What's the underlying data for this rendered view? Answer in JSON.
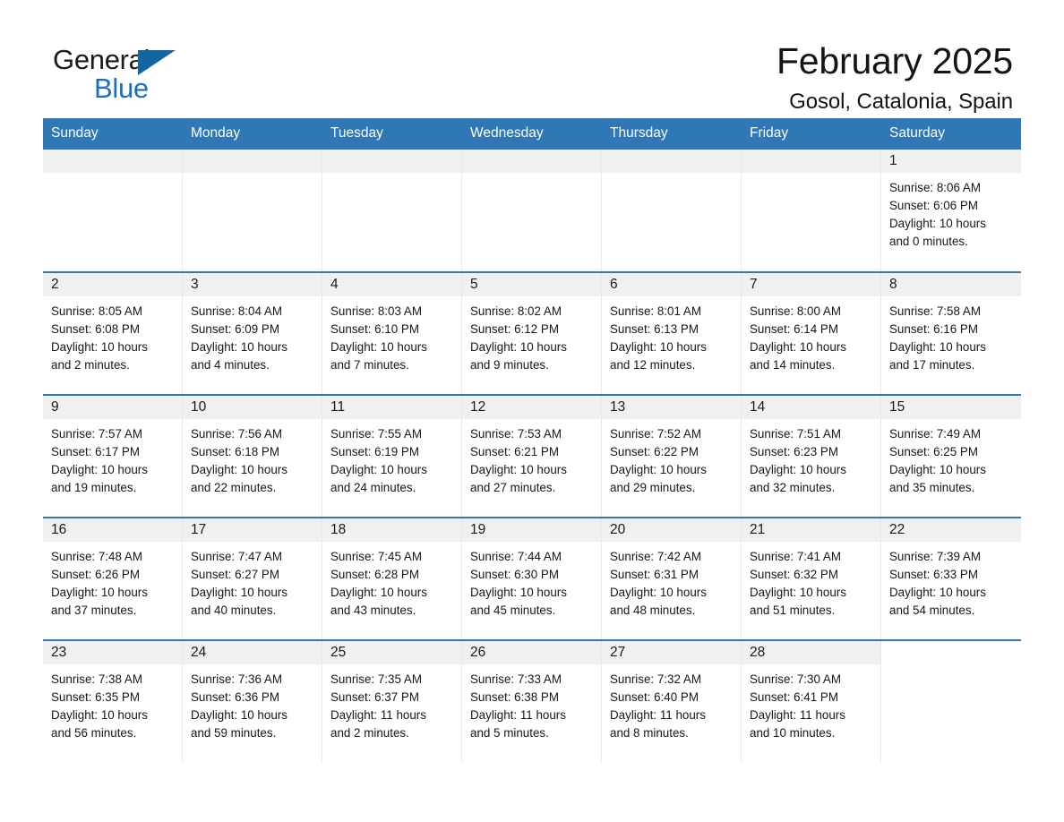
{
  "brand": {
    "name_part1": "General",
    "name_part2": "Blue",
    "logo_icon": "triangle-flag-icon",
    "colors": {
      "blue": "#1a6fc4",
      "triangle": "#12659e"
    }
  },
  "header": {
    "month_title": "February 2025",
    "location": "Gosol, Catalonia, Spain"
  },
  "theme": {
    "header_blue": "#2f78b5",
    "date_band_gray": "#f0f0f0",
    "cell_border": "#e9e9e9",
    "text": "#171717"
  },
  "weekdays": [
    "Sunday",
    "Monday",
    "Tuesday",
    "Wednesday",
    "Thursday",
    "Friday",
    "Saturday"
  ],
  "weeks": [
    [
      {
        "day": "",
        "blank": true
      },
      {
        "day": "",
        "blank": true
      },
      {
        "day": "",
        "blank": true
      },
      {
        "day": "",
        "blank": true
      },
      {
        "day": "",
        "blank": true
      },
      {
        "day": "",
        "blank": true
      },
      {
        "day": "1",
        "sunrise": "Sunrise: 8:06 AM",
        "sunset": "Sunset: 6:06 PM",
        "daylight_1": "Daylight: 10 hours",
        "daylight_2": "and 0 minutes."
      }
    ],
    [
      {
        "day": "2",
        "sunrise": "Sunrise: 8:05 AM",
        "sunset": "Sunset: 6:08 PM",
        "daylight_1": "Daylight: 10 hours",
        "daylight_2": "and 2 minutes."
      },
      {
        "day": "3",
        "sunrise": "Sunrise: 8:04 AM",
        "sunset": "Sunset: 6:09 PM",
        "daylight_1": "Daylight: 10 hours",
        "daylight_2": "and 4 minutes."
      },
      {
        "day": "4",
        "sunrise": "Sunrise: 8:03 AM",
        "sunset": "Sunset: 6:10 PM",
        "daylight_1": "Daylight: 10 hours",
        "daylight_2": "and 7 minutes."
      },
      {
        "day": "5",
        "sunrise": "Sunrise: 8:02 AM",
        "sunset": "Sunset: 6:12 PM",
        "daylight_1": "Daylight: 10 hours",
        "daylight_2": "and 9 minutes."
      },
      {
        "day": "6",
        "sunrise": "Sunrise: 8:01 AM",
        "sunset": "Sunset: 6:13 PM",
        "daylight_1": "Daylight: 10 hours",
        "daylight_2": "and 12 minutes."
      },
      {
        "day": "7",
        "sunrise": "Sunrise: 8:00 AM",
        "sunset": "Sunset: 6:14 PM",
        "daylight_1": "Daylight: 10 hours",
        "daylight_2": "and 14 minutes."
      },
      {
        "day": "8",
        "sunrise": "Sunrise: 7:58 AM",
        "sunset": "Sunset: 6:16 PM",
        "daylight_1": "Daylight: 10 hours",
        "daylight_2": "and 17 minutes."
      }
    ],
    [
      {
        "day": "9",
        "sunrise": "Sunrise: 7:57 AM",
        "sunset": "Sunset: 6:17 PM",
        "daylight_1": "Daylight: 10 hours",
        "daylight_2": "and 19 minutes."
      },
      {
        "day": "10",
        "sunrise": "Sunrise: 7:56 AM",
        "sunset": "Sunset: 6:18 PM",
        "daylight_1": "Daylight: 10 hours",
        "daylight_2": "and 22 minutes."
      },
      {
        "day": "11",
        "sunrise": "Sunrise: 7:55 AM",
        "sunset": "Sunset: 6:19 PM",
        "daylight_1": "Daylight: 10 hours",
        "daylight_2": "and 24 minutes."
      },
      {
        "day": "12",
        "sunrise": "Sunrise: 7:53 AM",
        "sunset": "Sunset: 6:21 PM",
        "daylight_1": "Daylight: 10 hours",
        "daylight_2": "and 27 minutes."
      },
      {
        "day": "13",
        "sunrise": "Sunrise: 7:52 AM",
        "sunset": "Sunset: 6:22 PM",
        "daylight_1": "Daylight: 10 hours",
        "daylight_2": "and 29 minutes."
      },
      {
        "day": "14",
        "sunrise": "Sunrise: 7:51 AM",
        "sunset": "Sunset: 6:23 PM",
        "daylight_1": "Daylight: 10 hours",
        "daylight_2": "and 32 minutes."
      },
      {
        "day": "15",
        "sunrise": "Sunrise: 7:49 AM",
        "sunset": "Sunset: 6:25 PM",
        "daylight_1": "Daylight: 10 hours",
        "daylight_2": "and 35 minutes."
      }
    ],
    [
      {
        "day": "16",
        "sunrise": "Sunrise: 7:48 AM",
        "sunset": "Sunset: 6:26 PM",
        "daylight_1": "Daylight: 10 hours",
        "daylight_2": "and 37 minutes."
      },
      {
        "day": "17",
        "sunrise": "Sunrise: 7:47 AM",
        "sunset": "Sunset: 6:27 PM",
        "daylight_1": "Daylight: 10 hours",
        "daylight_2": "and 40 minutes."
      },
      {
        "day": "18",
        "sunrise": "Sunrise: 7:45 AM",
        "sunset": "Sunset: 6:28 PM",
        "daylight_1": "Daylight: 10 hours",
        "daylight_2": "and 43 minutes."
      },
      {
        "day": "19",
        "sunrise": "Sunrise: 7:44 AM",
        "sunset": "Sunset: 6:30 PM",
        "daylight_1": "Daylight: 10 hours",
        "daylight_2": "and 45 minutes."
      },
      {
        "day": "20",
        "sunrise": "Sunrise: 7:42 AM",
        "sunset": "Sunset: 6:31 PM",
        "daylight_1": "Daylight: 10 hours",
        "daylight_2": "and 48 minutes."
      },
      {
        "day": "21",
        "sunrise": "Sunrise: 7:41 AM",
        "sunset": "Sunset: 6:32 PM",
        "daylight_1": "Daylight: 10 hours",
        "daylight_2": "and 51 minutes."
      },
      {
        "day": "22",
        "sunrise": "Sunrise: 7:39 AM",
        "sunset": "Sunset: 6:33 PM",
        "daylight_1": "Daylight: 10 hours",
        "daylight_2": "and 54 minutes."
      }
    ],
    [
      {
        "day": "23",
        "sunrise": "Sunrise: 7:38 AM",
        "sunset": "Sunset: 6:35 PM",
        "daylight_1": "Daylight: 10 hours",
        "daylight_2": "and 56 minutes."
      },
      {
        "day": "24",
        "sunrise": "Sunrise: 7:36 AM",
        "sunset": "Sunset: 6:36 PM",
        "daylight_1": "Daylight: 10 hours",
        "daylight_2": "and 59 minutes."
      },
      {
        "day": "25",
        "sunrise": "Sunrise: 7:35 AM",
        "sunset": "Sunset: 6:37 PM",
        "daylight_1": "Daylight: 11 hours",
        "daylight_2": "and 2 minutes."
      },
      {
        "day": "26",
        "sunrise": "Sunrise: 7:33 AM",
        "sunset": "Sunset: 6:38 PM",
        "daylight_1": "Daylight: 11 hours",
        "daylight_2": "and 5 minutes."
      },
      {
        "day": "27",
        "sunrise": "Sunrise: 7:32 AM",
        "sunset": "Sunset: 6:40 PM",
        "daylight_1": "Daylight: 11 hours",
        "daylight_2": "and 8 minutes."
      },
      {
        "day": "28",
        "sunrise": "Sunrise: 7:30 AM",
        "sunset": "Sunset: 6:41 PM",
        "daylight_1": "Daylight: 11 hours",
        "daylight_2": "and 10 minutes."
      },
      {
        "day": "",
        "blank": true,
        "tail": true
      }
    ]
  ]
}
